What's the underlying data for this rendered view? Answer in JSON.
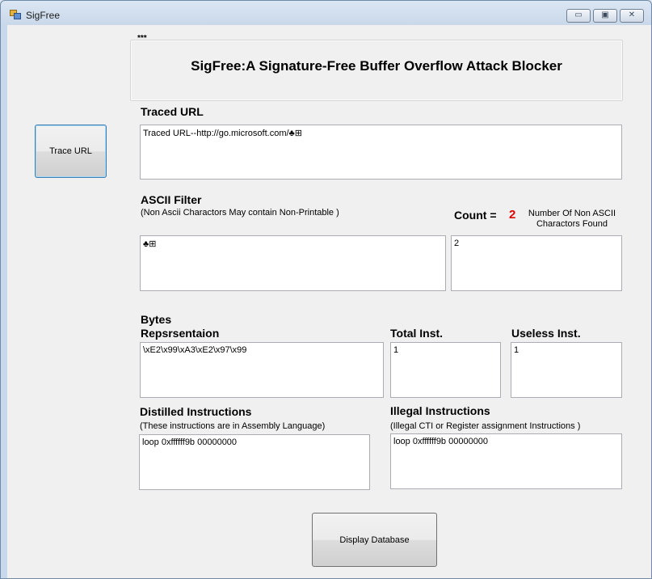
{
  "window": {
    "title": "SigFree",
    "controls": {
      "minimize": "▭",
      "maximize": "▣",
      "close": "✕"
    }
  },
  "header": {
    "tiny_label": "***",
    "title": "SigFree:A Signature-Free Buffer Overflow Attack Blocker"
  },
  "buttons": {
    "trace_url": "Trace URL",
    "display_database": "Display Database"
  },
  "traced_url": {
    "label": "Traced URL",
    "value": "Traced URL--http://go.microsoft.com/♣⊞"
  },
  "ascii_filter": {
    "label": "ASCII Filter",
    "note": "(Non Ascii Charactors May contain Non-Printable )",
    "value": "♣⊞",
    "count_label": "Count =",
    "count_value": "2",
    "count_desc_line1": "Number Of Non ASCII",
    "count_desc_line2": "Charactors Found",
    "count_box_value": "2"
  },
  "bytes": {
    "label_line1": "Bytes",
    "label_line2": "Repsrsentaion",
    "value": "\\xE2\\x99\\xA3\\xE2\\x97\\x99"
  },
  "total_inst": {
    "label": "Total Inst.",
    "value": "1"
  },
  "useless_inst": {
    "label": "Useless Inst.",
    "value": "1"
  },
  "distilled": {
    "label": "Distilled Instructions",
    "note": "(These instructions are in Assembly Language)",
    "value": "loop 0xffffff9b 00000000"
  },
  "illegal": {
    "label": "Illegal Instructions",
    "note": "(Illegal CTI or Register assignment Instructions )",
    "value": "loop 0xffffff9b 00000000"
  }
}
